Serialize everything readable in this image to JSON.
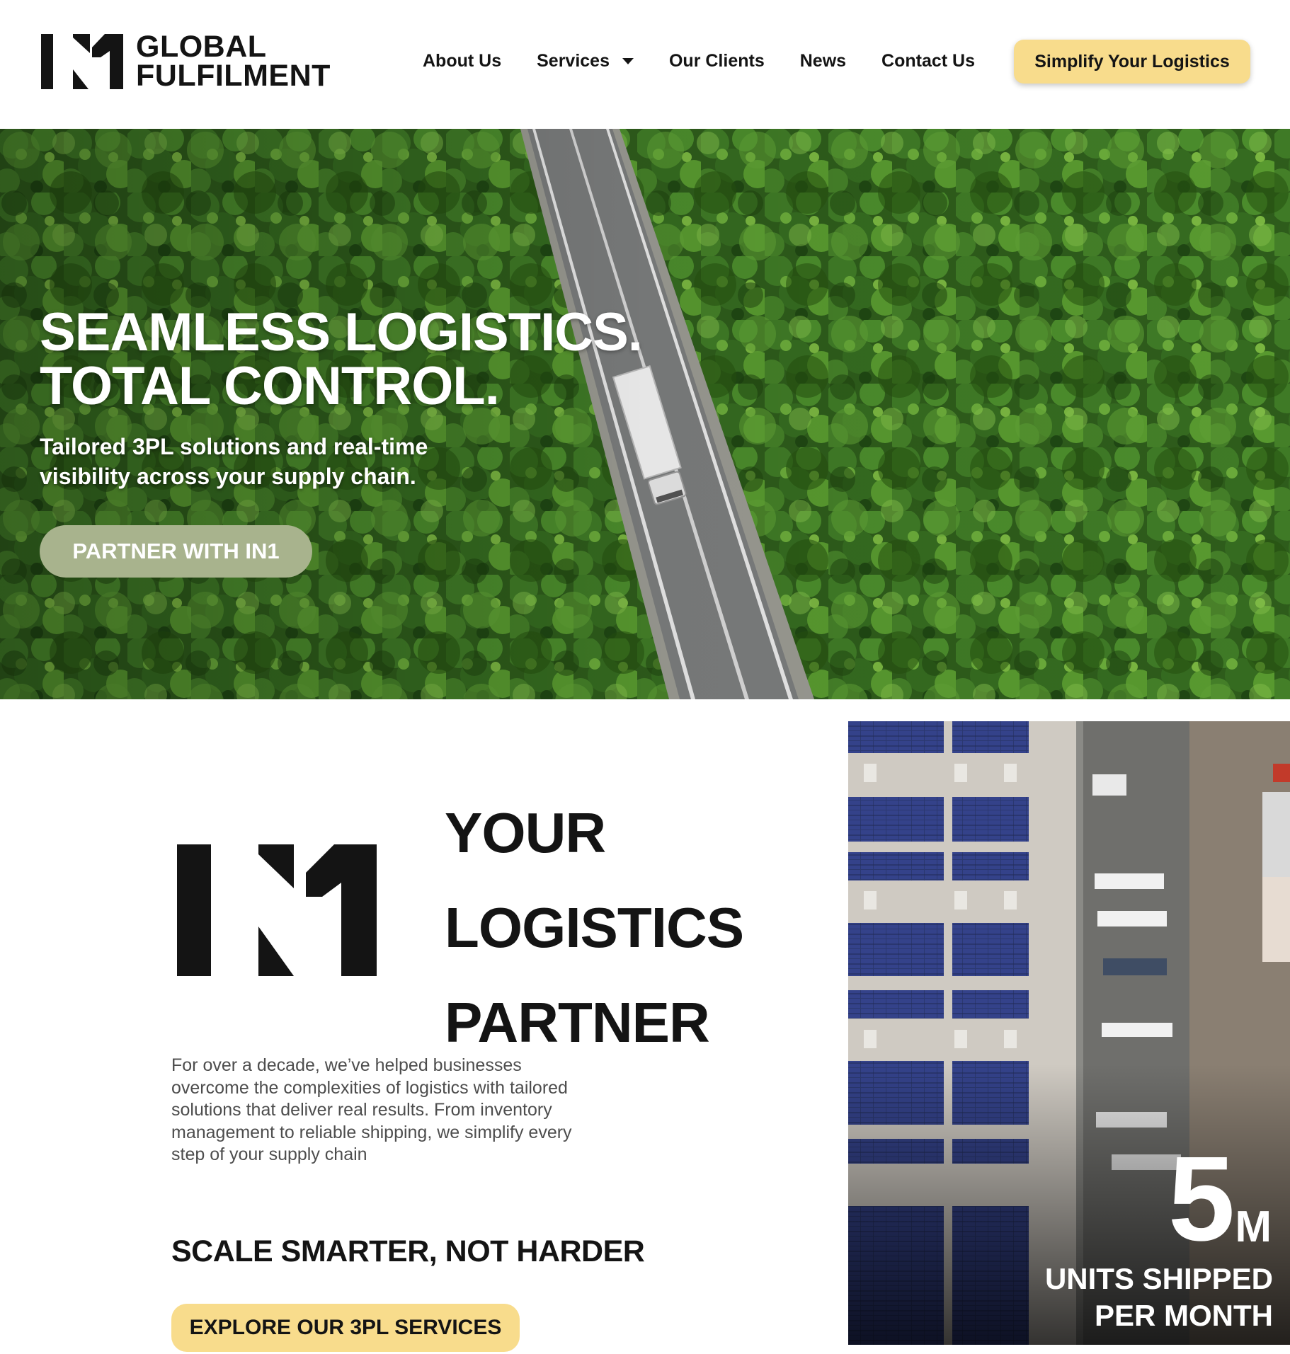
{
  "brand": {
    "name_line1": "GLOBAL",
    "name_line2": "FULFILMENT"
  },
  "nav": {
    "items": [
      "About Us",
      "Services",
      "Our Clients",
      "News",
      "Contact Us"
    ],
    "cta": "Simplify Your Logistics"
  },
  "hero": {
    "title_line1": "SEAMLESS LOGISTICS.",
    "title_line2": "TOTAL CONTROL.",
    "subtitle": "Tailored 3PL solutions and real-time visibility across your supply chain.",
    "button": "PARTNER WITH IN1"
  },
  "about": {
    "title_line1": "YOUR",
    "title_line2": "LOGISTICS",
    "title_line3": "PARTNER",
    "body": "For over a decade, we’ve helped businesses overcome the complexities of logistics with tailored solutions that deliver real results. From inventory management to reliable shipping, we simplify every step of your supply chain",
    "tagline": "SCALE SMARTER, NOT HARDER",
    "button": "EXPLORE OUR 3PL SERVICES"
  },
  "stat": {
    "number": "5",
    "unit": "M",
    "label_line1": "UNITS SHIPPED",
    "label_line2": "PER MONTH"
  },
  "colors": {
    "accent_yellow": "#f8dc8c",
    "sage_button": "#a8b38d",
    "text_dark": "#141414",
    "forest_green": "#2f5a1c"
  },
  "icons": {
    "logo": "in1-logo-icon",
    "services_dropdown": "chevron-down-icon"
  }
}
